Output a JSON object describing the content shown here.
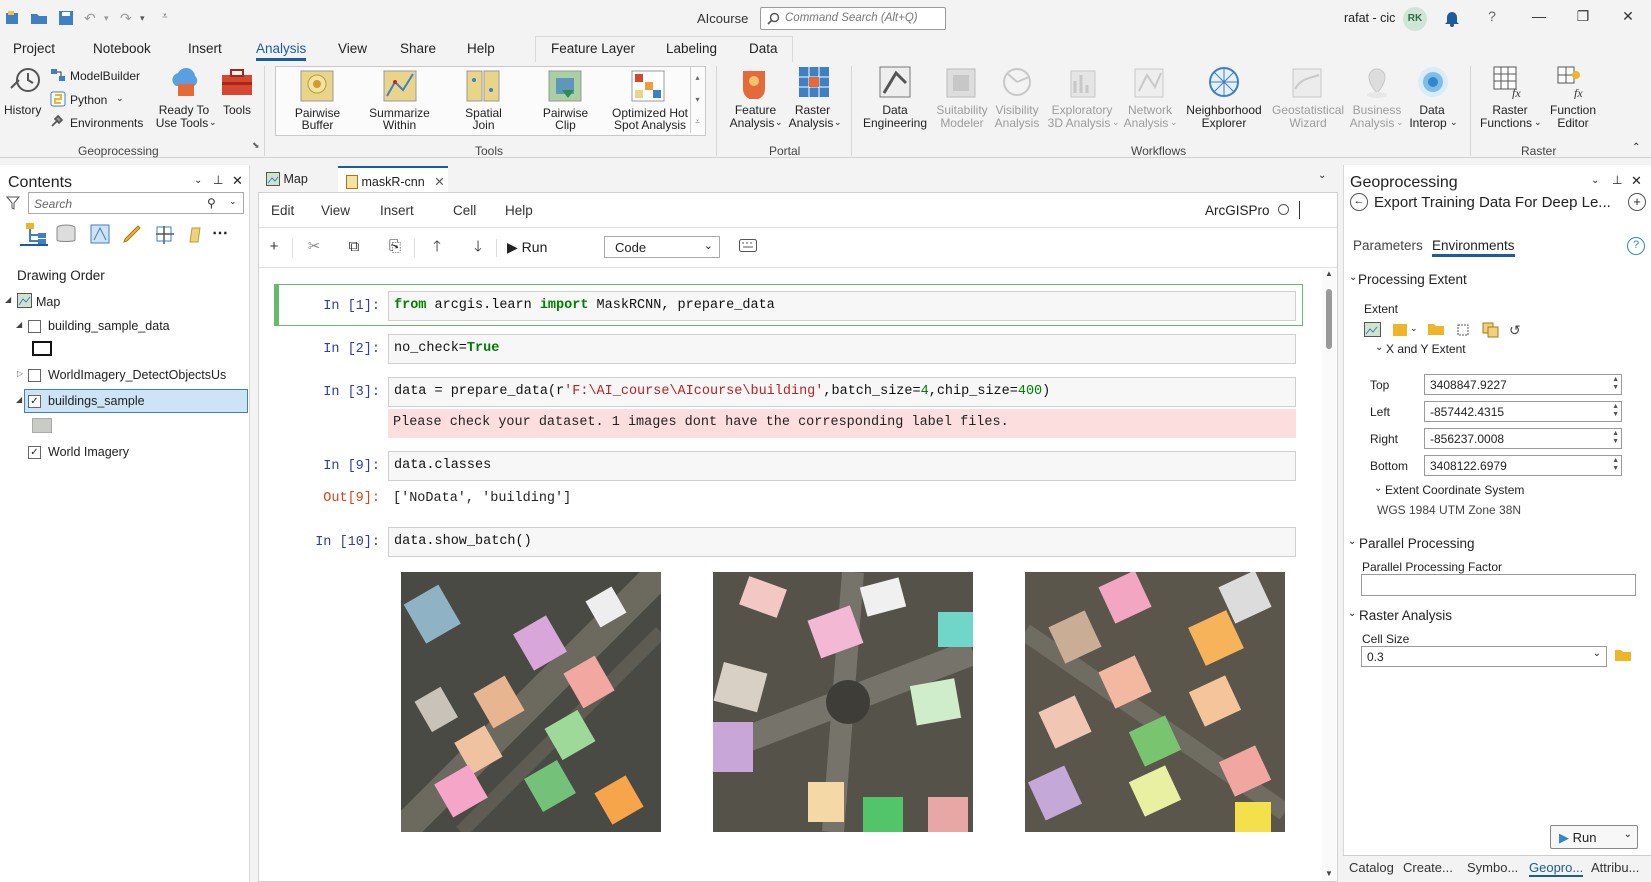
{
  "app": {
    "title": "AIcourse",
    "command_search_placeholder": "Command Search (Alt+Q)",
    "user_name": "rafat - cic",
    "user_initials": "RK"
  },
  "ribbon_tabs": [
    "Project",
    "Notebook",
    "Insert",
    "Analysis",
    "View",
    "Share",
    "Help"
  ],
  "active_tab": "Analysis",
  "context_tabs": [
    "Feature Layer",
    "Labeling",
    "Data"
  ],
  "ribbon": {
    "geoprocessing": {
      "history": "History",
      "modelbuilder": "ModelBuilder",
      "python": "Python",
      "environments": "Environments",
      "ready_to_use_1": "Ready To",
      "ready_to_use_2": "Use Tools",
      "tools": "Tools",
      "group": "Geoprocessing"
    },
    "tools": {
      "items": [
        {
          "l1": "Pairwise",
          "l2": "Buffer"
        },
        {
          "l1": "Summarize",
          "l2": "Within"
        },
        {
          "l1": "Spatial",
          "l2": "Join"
        },
        {
          "l1": "Pairwise",
          "l2": "Clip"
        },
        {
          "l1": "Optimized Hot",
          "l2": "Spot Analysis"
        }
      ],
      "group": "Tools"
    },
    "portal": {
      "feature_1": "Feature",
      "feature_2": "Analysis",
      "raster_1": "Raster",
      "raster_2": "Analysis",
      "group": "Portal"
    },
    "workflows": {
      "items": [
        {
          "l1": "Data",
          "l2": "Engineering",
          "enabled": true
        },
        {
          "l1": "Suitability",
          "l2": "Modeler",
          "enabled": false
        },
        {
          "l1": "Visibility",
          "l2": "Analysis",
          "enabled": false
        },
        {
          "l1": "Exploratory",
          "l2": "3D Analysis",
          "enabled": false
        },
        {
          "l1": "Network",
          "l2": "Analysis",
          "enabled": false
        },
        {
          "l1": "Neighborhood",
          "l2": "Explorer",
          "enabled": true
        },
        {
          "l1": "Geostatistical",
          "l2": "Wizard",
          "enabled": false
        },
        {
          "l1": "Business",
          "l2": "Analysis",
          "enabled": false
        },
        {
          "l1": "Data",
          "l2": "Interop",
          "enabled": true
        }
      ],
      "group": "Workflows"
    },
    "raster": {
      "rf_1": "Raster",
      "rf_2": "Functions",
      "fe_1": "Function",
      "fe_2": "Editor",
      "group": "Raster"
    }
  },
  "contents": {
    "title": "Contents",
    "search_placeholder": "Search",
    "drawing_order": "Drawing Order",
    "layers": [
      {
        "name": "Map",
        "checked": null
      },
      {
        "name": "building_sample_data",
        "checked": false
      },
      {
        "name": "WorldImagery_DetectObjectsUs",
        "checked": false
      },
      {
        "name": "buildings_sample",
        "checked": true
      },
      {
        "name": "World Imagery",
        "checked": true
      }
    ]
  },
  "doc_tabs": [
    "Map",
    "maskR-cnn"
  ],
  "notebook": {
    "menu": [
      "Edit",
      "View",
      "Insert",
      "Cell",
      "Help"
    ],
    "kernel": "ArcGISPro",
    "run_label": "Run",
    "cell_type": "Code",
    "cells": [
      {
        "prompt": "In [1]:",
        "parts": [
          [
            "kw",
            "from"
          ],
          [
            "",
            " arcgis.learn "
          ],
          [
            "kw",
            "import"
          ],
          [
            "",
            " MaskRCNN, prepare_data"
          ]
        ]
      },
      {
        "prompt": "In [2]:",
        "parts": [
          [
            "",
            "no_check="
          ],
          [
            "kw",
            "True"
          ]
        ]
      },
      {
        "prompt": "In [3]:",
        "parts": [
          [
            "",
            "data = prepare_data(r"
          ],
          [
            "str",
            "'F:\\AI_course\\AIcourse\\building'"
          ],
          [
            "",
            ",batch_size="
          ],
          [
            "num",
            "4"
          ],
          [
            "",
            ",chip_size="
          ],
          [
            "num",
            "400"
          ],
          [
            "",
            ")"
          ]
        ]
      },
      {
        "prompt": "In [9]:",
        "parts": [
          [
            "",
            "data.classes"
          ]
        ]
      },
      {
        "prompt": "In [10]:",
        "parts": [
          [
            "",
            "data.show_batch()"
          ]
        ]
      }
    ],
    "warning": "Please check your dataset. 1 images dont have the corresponding label files.",
    "out_prompt": "Out[9]:",
    "out_text": "['NoData', 'building']"
  },
  "geoprocessing": {
    "title": "Geoprocessing",
    "tool_name": "Export Training Data For Deep Le...",
    "tabs": [
      "Parameters",
      "Environments"
    ],
    "processing_extent": "Processing Extent",
    "extent_label": "Extent",
    "xy_extent": "X and Y Extent",
    "top_label": "Top",
    "top": "3408847.9227",
    "left_label": "Left",
    "left": "-857442.4315",
    "right_label": "Right",
    "right": "-856237.0008",
    "bottom_label": "Bottom",
    "bottom": "3408122.6979",
    "extent_cs": "Extent Coordinate System",
    "cs_value": "WGS 1984 UTM Zone 38N",
    "parallel_processing": "Parallel Processing",
    "ppf_label": "Parallel Processing Factor",
    "ppf_value": "",
    "raster_analysis": "Raster Analysis",
    "cell_size_label": "Cell Size",
    "cell_size": "0.3",
    "run_label": "Run"
  },
  "bottom_tabs": [
    "Catalog",
    "Create...",
    "Symbo...",
    "Geopro...",
    "Attribu..."
  ],
  "colors": {
    "accent": "#1b5c9e",
    "active_cell": "#66bb6a",
    "warning_bg": "#fddede"
  }
}
